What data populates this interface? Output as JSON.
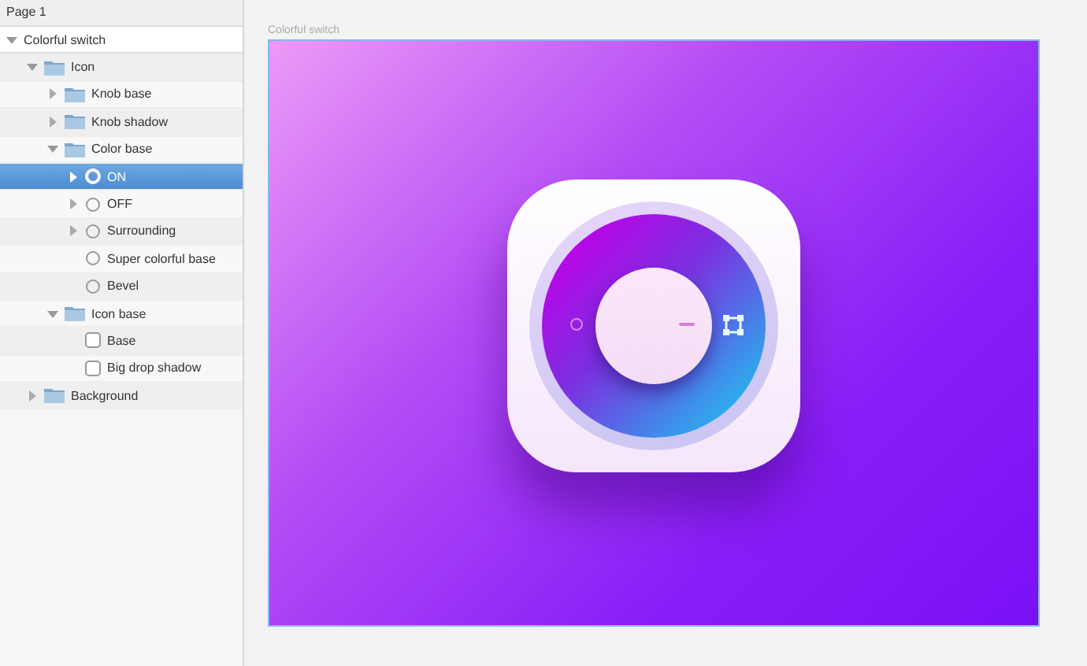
{
  "sidebar": {
    "page": "Page 1",
    "layers": [
      {
        "name": "Colorful switch",
        "kind": "artboard",
        "expanded": true,
        "selected": false,
        "children": [
          {
            "name": "Icon",
            "kind": "folder",
            "expanded": true,
            "selected": false,
            "children": [
              {
                "name": "Knob base",
                "kind": "folder",
                "expanded": false,
                "selected": false
              },
              {
                "name": "Knob shadow",
                "kind": "folder",
                "expanded": false,
                "selected": false
              },
              {
                "name": "Color base",
                "kind": "folder",
                "expanded": true,
                "selected": false,
                "children": [
                  {
                    "name": "ON",
                    "kind": "oval",
                    "expanded": false,
                    "selected": true
                  },
                  {
                    "name": "OFF",
                    "kind": "oval",
                    "expanded": false,
                    "selected": false
                  },
                  {
                    "name": "Surrounding",
                    "kind": "oval",
                    "expanded": false,
                    "selected": false
                  },
                  {
                    "name": "Super colorful base",
                    "kind": "oval",
                    "selected": false
                  },
                  {
                    "name": "Bevel",
                    "kind": "oval",
                    "selected": false
                  }
                ]
              },
              {
                "name": "Icon base",
                "kind": "folder",
                "expanded": true,
                "selected": false,
                "children": [
                  {
                    "name": "Base",
                    "kind": "rect",
                    "selected": false
                  },
                  {
                    "name": "Big drop shadow",
                    "kind": "rect",
                    "selected": false
                  }
                ]
              }
            ]
          },
          {
            "name": "Background",
            "kind": "folder",
            "expanded": false,
            "selected": false
          }
        ]
      }
    ]
  },
  "canvas": {
    "artboard_label": "Colorful switch"
  }
}
